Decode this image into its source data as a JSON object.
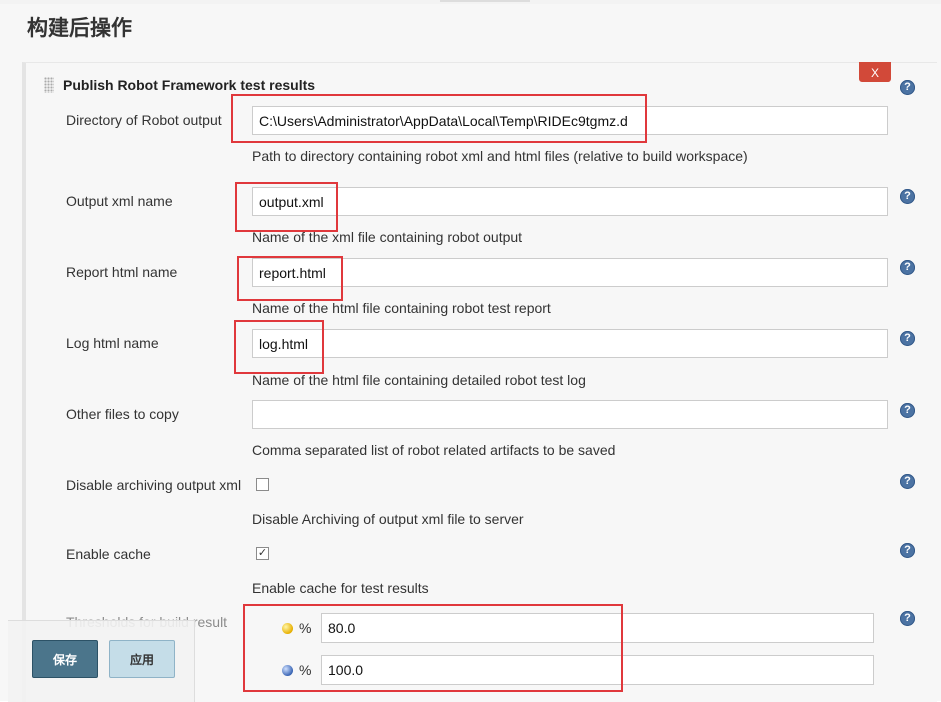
{
  "section": {
    "title": "构建后操作"
  },
  "block": {
    "title": "Publish Robot Framework test results",
    "delete_label": "X"
  },
  "help_glyph": "?",
  "fields": {
    "output_dir": {
      "label": "Directory of Robot output",
      "value": "C:\\Users\\Administrator\\AppData\\Local\\Temp\\RIDEc9tgmz.d",
      "description": "Path to directory containing robot xml and html files (relative to build workspace)"
    },
    "output_xml": {
      "label": "Output xml name",
      "value": "output.xml",
      "description": "Name of the xml file containing robot output"
    },
    "report_html": {
      "label": "Report html name",
      "value": "report.html",
      "description": "Name of the html file containing robot test report"
    },
    "log_html": {
      "label": "Log html name",
      "value": "log.html",
      "description": "Name of the html file containing detailed robot test log"
    },
    "other_files": {
      "label": "Other files to copy",
      "value": "",
      "description": "Comma separated list of robot related artifacts to be saved"
    },
    "disable_archiving": {
      "label": "Disable archiving output xml",
      "checked": false,
      "description": "Disable Archiving of output xml file to server"
    },
    "enable_cache": {
      "label": "Enable cache",
      "checked": true,
      "check_glyph": "✓",
      "description": "Enable cache for test results"
    },
    "thresholds": {
      "label": "Thresholds for build result",
      "unstable": {
        "icon": "yellow-ball-icon",
        "unit": "%",
        "value": "80.0"
      },
      "pass": {
        "icon": "blue-ball-icon",
        "unit": "%",
        "value": "100.0"
      }
    }
  },
  "buttons": {
    "save": "保存",
    "apply": "应用"
  },
  "colors": {
    "highlight": "#e0383c",
    "delete": "#d24939",
    "help": "#4c73a3"
  }
}
